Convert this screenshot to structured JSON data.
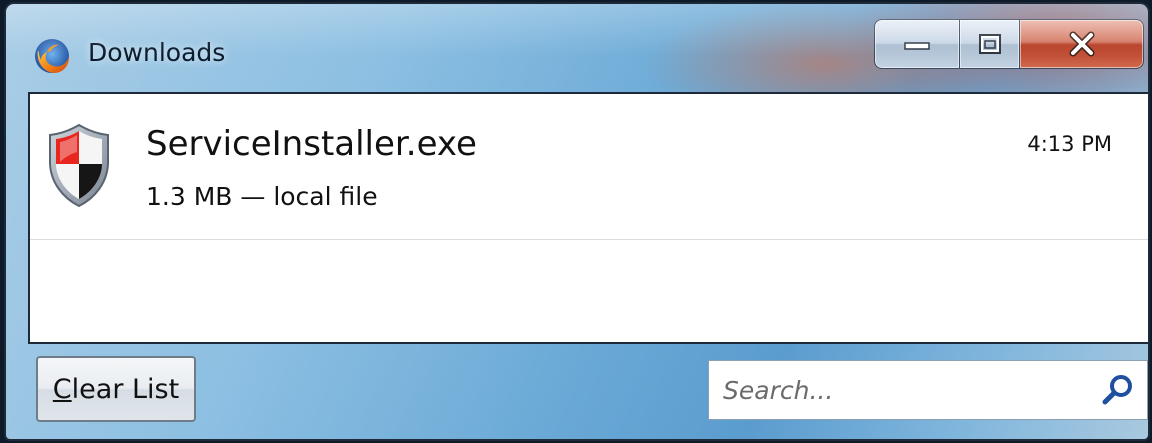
{
  "window": {
    "title": "Downloads",
    "app_icon": "firefox-icon",
    "controls": [
      "minimize-icon",
      "maximize-icon",
      "close-icon"
    ]
  },
  "downloads": [
    {
      "icon": "security-shield-icon",
      "filename": "ServiceInstaller.exe",
      "status": "1.3 MB — local file",
      "time": "4:13 PM"
    }
  ],
  "footer": {
    "clear_button": {
      "mnemonic": "C",
      "rest": "lear List"
    },
    "search": {
      "placeholder": "Search...",
      "value": ""
    }
  }
}
